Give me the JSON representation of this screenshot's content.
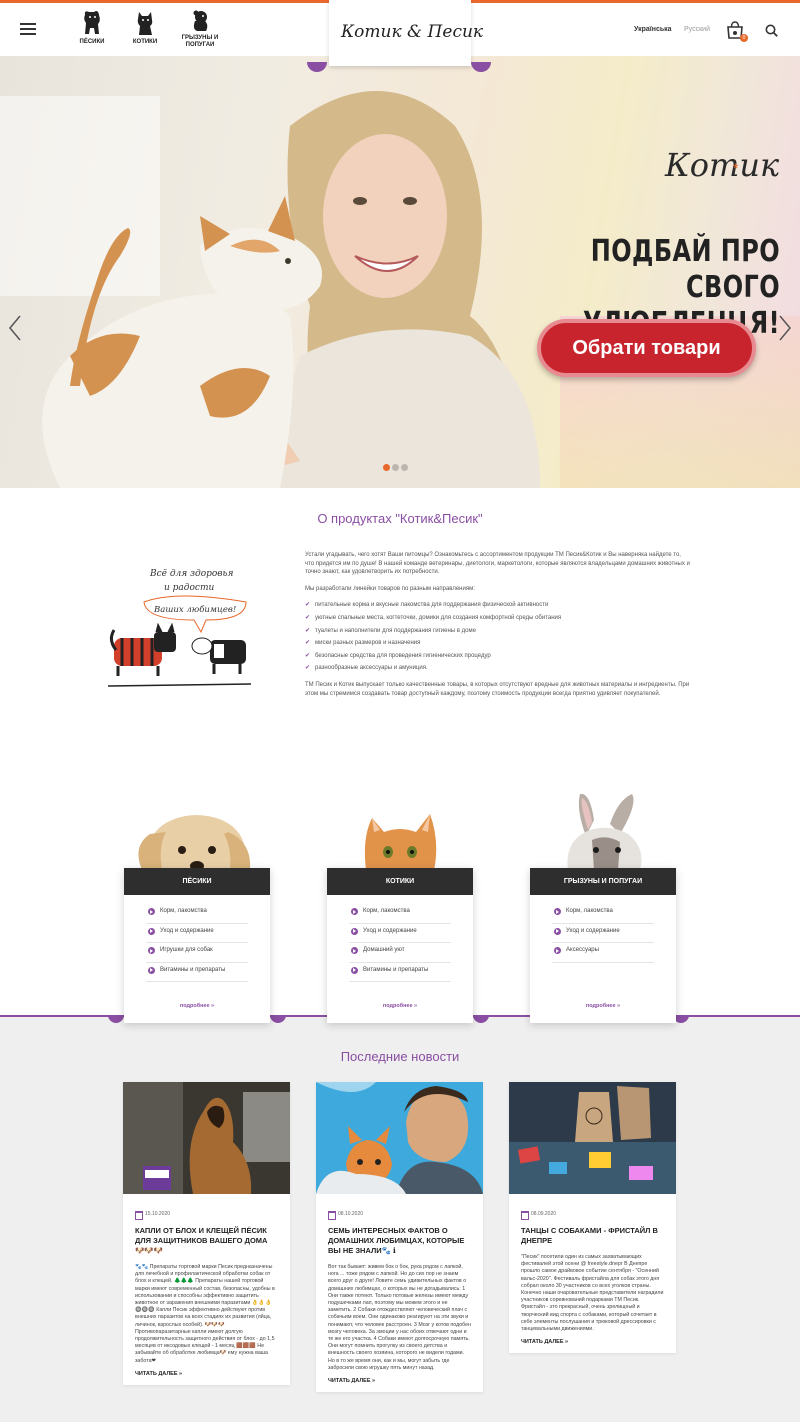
{
  "colors": {
    "accent": "#e8672a",
    "purple": "#8a4fa3",
    "dark": "#2e2e2e",
    "cta": "#c8242e"
  },
  "header": {
    "nav": [
      {
        "label": "ПЁСИКИ",
        "icon": "dog-icon"
      },
      {
        "label": "КОТИКИ",
        "icon": "cat-icon"
      },
      {
        "label": "ГРЫЗУНЫ И ПОПУГАИ",
        "icon": "rodent-icon"
      }
    ],
    "logo": "Котик & Песик",
    "lang_active": "Українська",
    "lang_other": "Русский",
    "cart_count": "0"
  },
  "hero": {
    "brand": "Котик",
    "title_line1": "ПОДБАЙ ПРО",
    "title_line2": "СВОГО УЛЮБЛЕНЦЯ!",
    "cta": "Обрати товари",
    "slide_count": 3,
    "active_slide": 1
  },
  "about": {
    "title": "О продуктах \"Котик&Песик\"",
    "illustration_text": "Всё для здоровья и радости Ваших любимцев!",
    "intro": "Устали угадывать, чего хотят Ваши питомцы? Ознакомьтесь с ассортиментом продукции ТМ Песик&Котик и Вы наверняка найдете то, что придется им по душе! В нашей команде ветеринары, диетологи, маркетологи, которые являются владельцами домашних животных и точно знают, как удовлетворить их потребности.",
    "lines_intro": "Мы разработали линейки товаров по разным направлениям:",
    "items": [
      "питательные корма и вкусные лакомства для поддержания физической активности",
      "уютные спальные места, когтеточки, домики для создания комфортной среды обитания",
      "туалеты и наполнители для поддержания гигиены в доме",
      "миски разных размеров и назначения",
      "безопасные средства для проведения гигиенических процедур",
      "разнообразные аксессуары и амуниция."
    ],
    "outro": "ТМ Песик и Котик выпускает только качественные товары, в которых отсутствуют вредные для животных материалы и ингредиенты. При этом мы стремимся создавать товар доступный каждому, поэтому стоимость продукции всегда приятно удивляет покупателей."
  },
  "categories": [
    {
      "title": "ПЁСИКИ",
      "items": [
        "Корм, лакомства",
        "Уход и содержание",
        "Игрушки для собак",
        "Витамины и препараты"
      ],
      "more": "подробнее »"
    },
    {
      "title": "КОТИКИ",
      "items": [
        "Корм, лакомства",
        "Уход и содержание",
        "Домашний уют",
        "Витамины и препараты"
      ],
      "more": "подробнее »"
    },
    {
      "title": "ГРЫЗУНЫ И ПОПУГАИ",
      "items": [
        "Корм, лакомства",
        "Уход и содержание",
        "Аксессуары"
      ],
      "more": "подробнее »"
    }
  ],
  "news": {
    "title": "Последние новости",
    "items": [
      {
        "date": "15.10.2020",
        "title": "КАПЛИ ОТ БЛОХ И КЛЕЩЕЙ ПЁСИК ДЛЯ ЗАЩИТНИКОВ ВАШЕГО ДОМА 🐶🐶🐶",
        "body": "🐾🐾 Препараты торговой марки Песик предназначены для лечебной и профилактической обработки собак от блох и клещей. 🌲🌲🌲 Препараты нашей торговой марки имеют современный состав, безопасны, удобны в использовании и способны эффективно защитить животное от заражения внешними паразитами 👌👌👌 🔘🔘🔘 Капли Песик эффективно действуют против внешних паразитов на всех стадиях их развития (яйца, личинок, взрослых особей). 🐶🐶🐶 Противопаразитарные капли имеют долгую продолжительность защитного действия от блох - до 1,5 месяцев от иксодовых клещей - 1 месяц 🟫🟫🟫 Не забывайте об обработке любимца🐶 ему нужна ваша забота❤",
        "more": "ЧИТАТЬ ДАЛЕЕ »"
      },
      {
        "date": "08.10.2020",
        "title": "СЕМЬ ИНТЕРЕСНЫХ ФАКТОВ О ДОМАШНИХ ЛЮБИМЦАХ, КОТОРЫЕ ВЫ НЕ ЗНАЛИ🐾 ℹ",
        "body": "Вот так бывает: живем бок о бок, рука рядом с лапкой, нога ... тоже рядом с лапкой. Но до сих пор не знаем всего друг о друге! Ловите семь удивительных фактов о домашних любимцах, о которых вы не догадывались: 1 Они также потеют. Только потовые железы имеют между подушечками лап, поэтому мы можем этого и не заметить. 2 Собаки отождествляют человеческий плач с собачьим воем. Они одинаково реагируют на эти звуки и понимают, что человек расстроен. 3 Мозг у котов подобен мозгу человека. За эмоции у нас обоих отвечают одни и те же его участка. 4 Собаки имеют долгосрочную память. Они могут помнить прогулку из своего детства и внешность своего хозяина, которого не видели годами. Но в то же время они, как и мы, могут забыть где забросили свою игрушку пять минут назад.",
        "more": "ЧИТАТЬ ДАЛЕЕ »"
      },
      {
        "date": "08.09.2020",
        "title": "ТАНЦЫ С СОБАКАМИ - ФРИСТАЙЛ В ДНЕПРЕ",
        "body": "\"Песик\" посетили один из самых захватывающих фестивалей этой осени @ freestyle.dnepr В Днепре прошло самое драйвовое событие сентября - \"Осенний вальс-2020\". Фестиваль фристайла для собак этого дня собрал около 30 участников со всех уголков страны. Конечно наши очаровательные представители наградили участников соревнований подарками ТМ Песик. Фристайл - это прекрасный, очень зрелищный и творческий вид спорта с собаками, который сочетает в себе элементы послушания и трюковой дрессировки с танцевальными движениями.",
        "more": "ЧИТАТЬ ДАЛЕЕ »"
      }
    ]
  }
}
